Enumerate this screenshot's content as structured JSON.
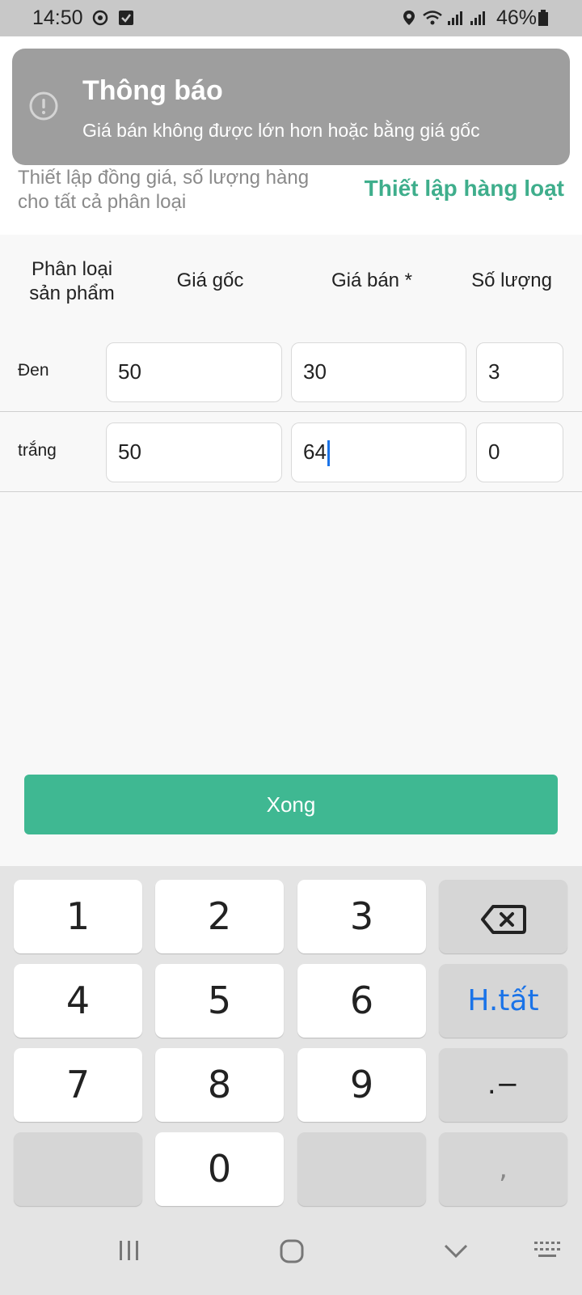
{
  "status_bar": {
    "time": "14:50",
    "battery": "46%"
  },
  "toast": {
    "title": "Thông báo",
    "message": "Giá bán không được lớn hơn hoặc bằng giá gốc",
    "icon": "alert-circle-icon"
  },
  "bulk_setup": {
    "description": "Thiết lập đồng giá, số lượng hàng cho tất cả phân loại",
    "link_label": "Thiết lập hàng loạt"
  },
  "table": {
    "headers": {
      "variant_line1": "Phân loại",
      "variant_line2": "sản phẩm",
      "original_price": "Giá gốc",
      "sale_price": "Giá bán *",
      "quantity": "Số lượng"
    },
    "rows": [
      {
        "variant": "Đen",
        "original_price": "50",
        "sale_price": "30",
        "quantity": "3"
      },
      {
        "variant": "trắng",
        "original_price": "50",
        "sale_price": "64",
        "quantity": "0"
      }
    ]
  },
  "done_button": "Xong",
  "keyboard": {
    "keys": [
      "1",
      "2",
      "3",
      "4",
      "5",
      "6",
      "7",
      "8",
      "9",
      "0"
    ],
    "clear_all": "H.tất",
    "dot_minus": ".−",
    "comma": ","
  },
  "colors": {
    "accent": "#3fb892",
    "link": "#3fae8c",
    "toast_bg": "#9e9e9e",
    "cursor": "#1a73e8"
  }
}
